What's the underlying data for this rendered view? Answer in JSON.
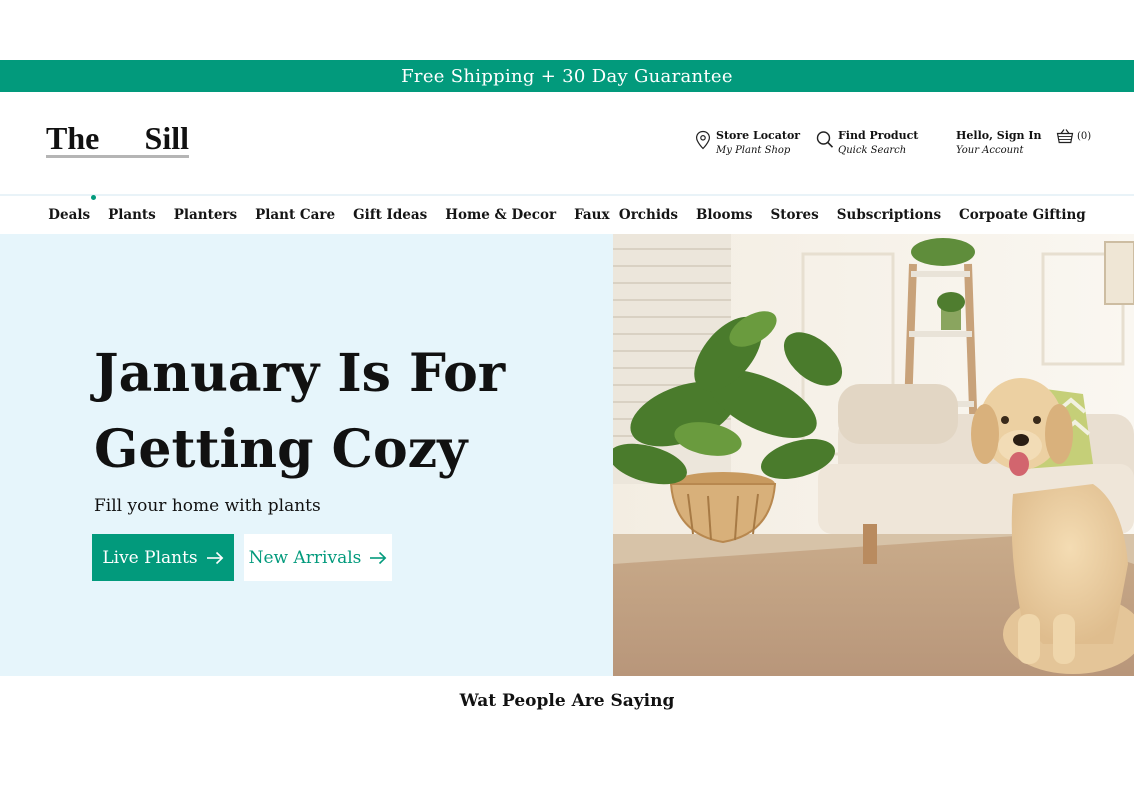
{
  "announcement": "Free Shipping + 30 Day Guarantee",
  "logo": {
    "word1": "The",
    "word2": "Sill"
  },
  "header_links": {
    "store_locator": {
      "title": "Store Locator",
      "subtitle": "My Plant Shop"
    },
    "find_product": {
      "title": "Find Product",
      "subtitle": "Quick Search"
    },
    "account": {
      "title": "Hello, Sign In",
      "subtitle": "Your Account"
    },
    "cart_count": "(0)"
  },
  "nav": {
    "items": [
      {
        "label": "Deals"
      },
      {
        "label": "Plants"
      },
      {
        "label": "Planters"
      },
      {
        "label": "Plant Care"
      },
      {
        "label": "Gift Ideas"
      },
      {
        "label": "Home & Decor"
      },
      {
        "label": "Faux  Orchids"
      },
      {
        "label": "Blooms"
      },
      {
        "label": "Stores"
      },
      {
        "label": "Subscriptions"
      },
      {
        "label": "Corpoate Gifting"
      }
    ]
  },
  "hero": {
    "title_line1": "January Is For",
    "title_line2": "Getting Cozy",
    "subtitle": "Fill your home with plants",
    "primary_button": "Live Plants",
    "secondary_button": "New Arrivals"
  },
  "section": {
    "title": "Wat People Are Saying"
  },
  "colors": {
    "brand_green": "#029A7C",
    "hero_bg": "#E6F5FB"
  }
}
